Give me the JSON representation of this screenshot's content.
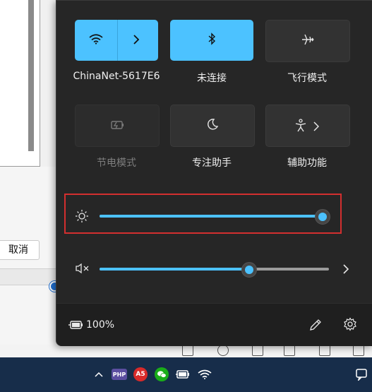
{
  "background": {
    "cancel_label": "取消"
  },
  "quick_settings": {
    "tiles": [
      {
        "id": "wifi",
        "label": "ChinaNet-5617E6",
        "state": "on",
        "icon": "wifi-icon",
        "has_chevron": true
      },
      {
        "id": "bluetooth",
        "label": "未连接",
        "state": "on",
        "icon": "bluetooth-icon"
      },
      {
        "id": "airplane",
        "label": "飞行模式",
        "state": "off",
        "icon": "airplane-icon"
      },
      {
        "id": "battery_saver",
        "label": "节电模式",
        "state": "disabled",
        "icon": "battery-saver-icon"
      },
      {
        "id": "focus",
        "label": "专注助手",
        "state": "off",
        "icon": "moon-icon"
      },
      {
        "id": "accessibility",
        "label": "辅助功能",
        "state": "off",
        "icon": "accessibility-icon",
        "has_chevron": true
      }
    ],
    "brightness": {
      "icon": "sun-icon",
      "value": 1.0
    },
    "volume": {
      "icon": "volume-muted-icon",
      "value": 0.65
    },
    "battery_text": "100%",
    "accent": "#4cc2ff"
  },
  "taskbar": {
    "php_badge": "PHP",
    "a5_badge": "A5"
  }
}
